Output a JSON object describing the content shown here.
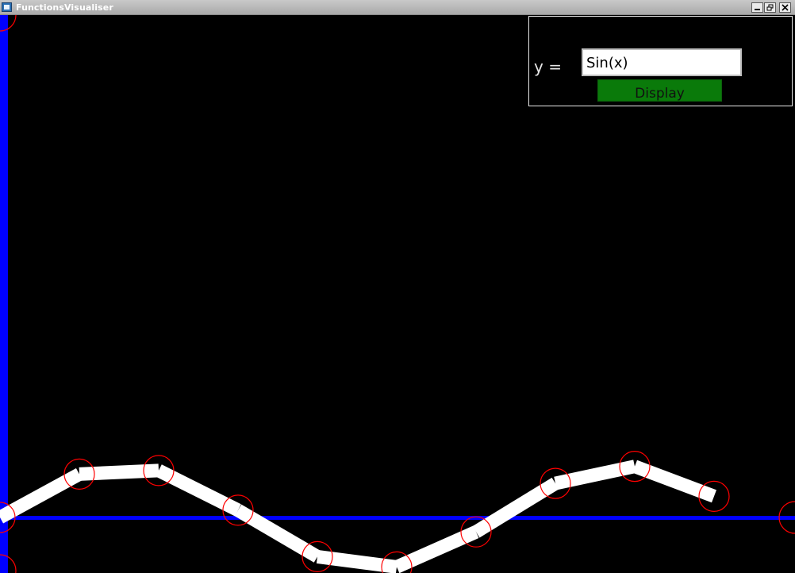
{
  "window": {
    "title": "FunctionsVisualiser",
    "controls": [
      "minimize-icon",
      "restore-icon",
      "close-icon"
    ]
  },
  "panel": {
    "y_label": "y =",
    "input_value": "Sin(x)",
    "display_label": "Display"
  },
  "colors": {
    "background": "#000000",
    "axis": "#0000ff",
    "curve": "#ffffff",
    "marker": "#ff0000",
    "button": "#0a7a0a"
  },
  "plot": {
    "function": "Sin(x)",
    "x": [
      0,
      1,
      2,
      3,
      4,
      5,
      6,
      7,
      8,
      9
    ],
    "y": [
      0.0,
      0.84,
      0.91,
      0.14,
      -0.76,
      -0.96,
      -0.28,
      0.66,
      0.99,
      0.41
    ]
  }
}
